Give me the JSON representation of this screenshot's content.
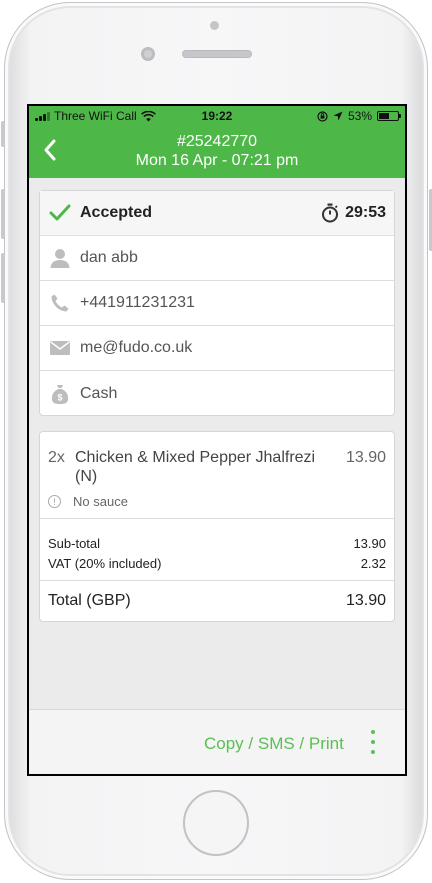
{
  "status_bar": {
    "carrier": "Three WiFi Call",
    "time": "19:22",
    "battery": "53%",
    "battery_level": 0.53
  },
  "header": {
    "order_number": "#25242770",
    "order_datetime": "Mon 16 Apr - 07:21 pm"
  },
  "order_info": {
    "status": "Accepted",
    "timer": "29:53",
    "customer_name": "dan abb",
    "phone": "+441911231231",
    "email": "me@fudo.co.uk",
    "payment": "Cash"
  },
  "items": [
    {
      "qty": "2x",
      "name": "Chicken & Mixed Pepper Jhalfrezi (N)",
      "price": "13.90",
      "note": "No sauce"
    }
  ],
  "totals": {
    "subtotal_label": "Sub-total",
    "subtotal_value": "13.90",
    "vat_label": "VAT (20% included)",
    "vat_value": "2.32",
    "total_label": "Total (GBP)",
    "total_value": "13.90"
  },
  "footer": {
    "copy_label": "Copy / SMS / Print"
  },
  "colors": {
    "accent_green": "#4db848",
    "link_green": "#58c153"
  }
}
